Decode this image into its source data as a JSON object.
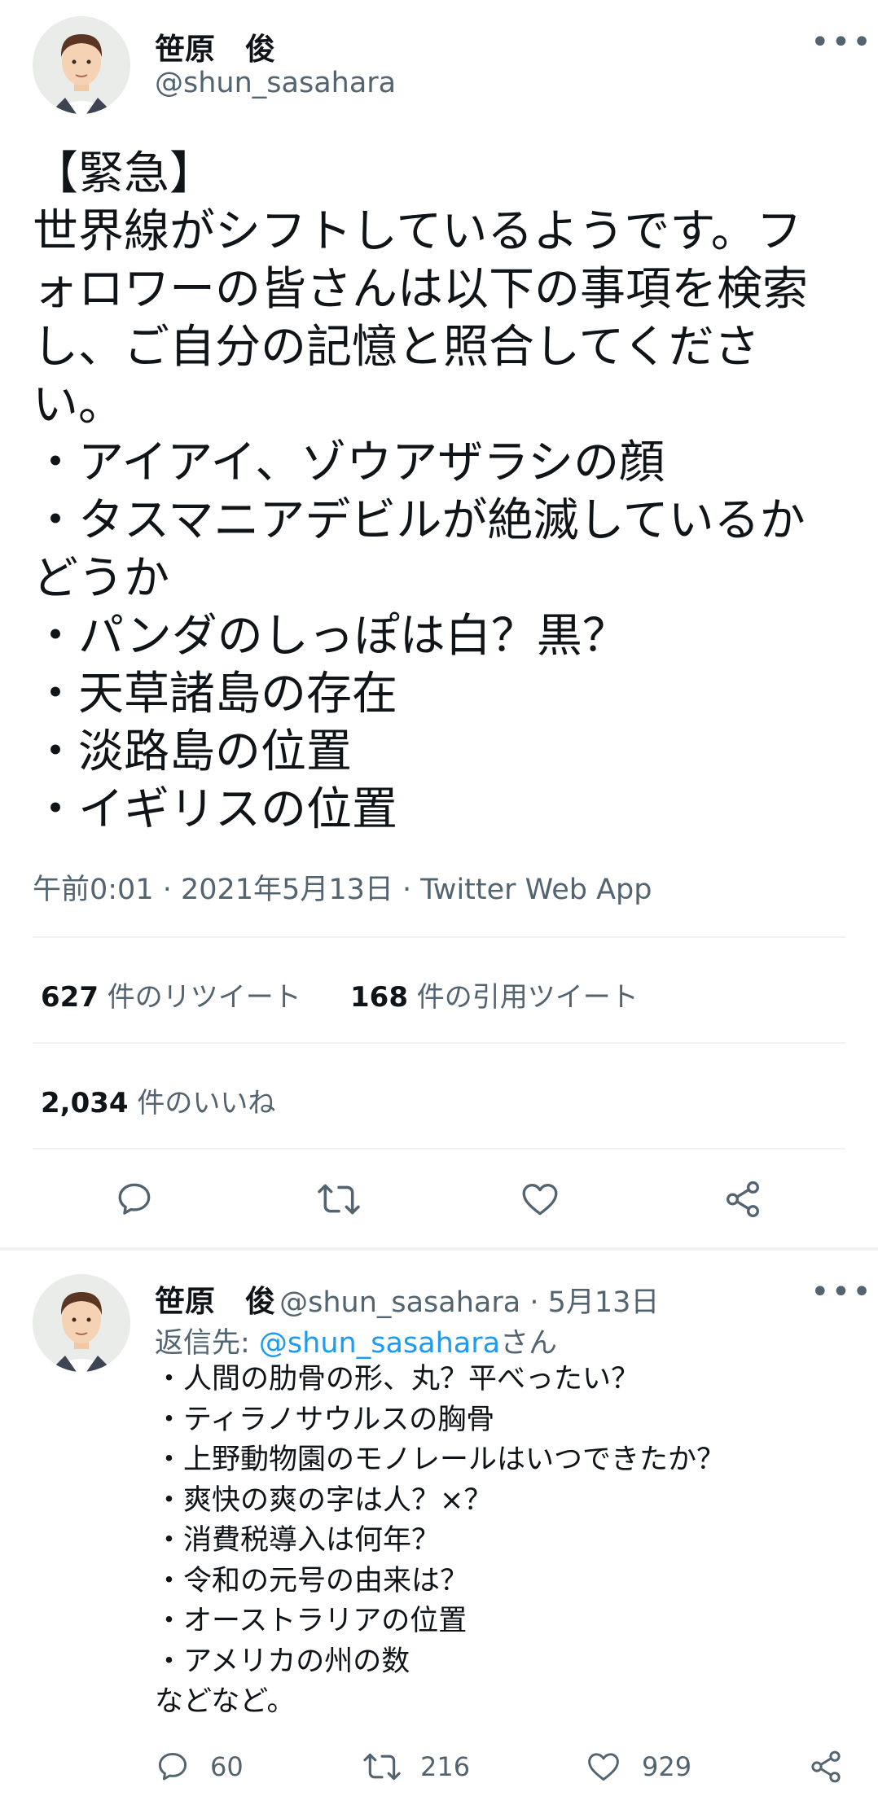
{
  "main_tweet": {
    "author_name": "笹原　俊",
    "author_handle": "@shun_sasahara",
    "more_label": "•••",
    "text_lines": [
      "【緊急】",
      "世界線がシフトしているようです。フ",
      "ォロワーの皆さんは以下の事項を検索",
      "し、ご自分の記憶と照合してくださ",
      "い。",
      "・アイアイ、ゾウアザラシの顔",
      "・タスマニアデビルが絶滅しているか",
      "どうか",
      "・パンダのしっぽは白？黒？",
      "・天草諸島の存在",
      "・淡路島の位置",
      "・イギリスの位置"
    ],
    "timestamp": "午前0:01 · 2021年5月13日 · Twitter Web App",
    "retweets_count": "627",
    "retweets_label": " 件のリツイート",
    "quotes_count": "168",
    "quotes_label": " 件の引用ツイート",
    "likes_count": "2,034",
    "likes_label": " 件のいいね"
  },
  "reply_tweet": {
    "author_name": "笹原　俊",
    "author_handle_date": "@shun_sasahara · 5月13日",
    "more_label": "•••",
    "reply_to_prefix": "返信先: ",
    "reply_to_handle": "@shun_sasahara",
    "reply_to_suffix": "さん",
    "text_lines": [
      "・人間の肋骨の形、丸？平べったい？",
      "・ティラノサウルスの胸骨",
      "・上野動物園のモノレールはいつできたか？",
      "・爽快の爽の字は人？×？",
      "・消費税導入は何年？",
      "・令和の元号の由来は？",
      "・オーストラリアの位置",
      "・アメリカの州の数",
      "などなど。"
    ],
    "reply_count": "60",
    "retweet_count": "216",
    "like_count": "929"
  },
  "icons": [
    "reply-icon",
    "retweet-icon",
    "like-icon",
    "share-icon",
    "more-icon"
  ],
  "colors": {
    "text": "#0f1419",
    "secondary": "#536471",
    "link": "#1d9bf0",
    "divider": "#eff3f4"
  }
}
